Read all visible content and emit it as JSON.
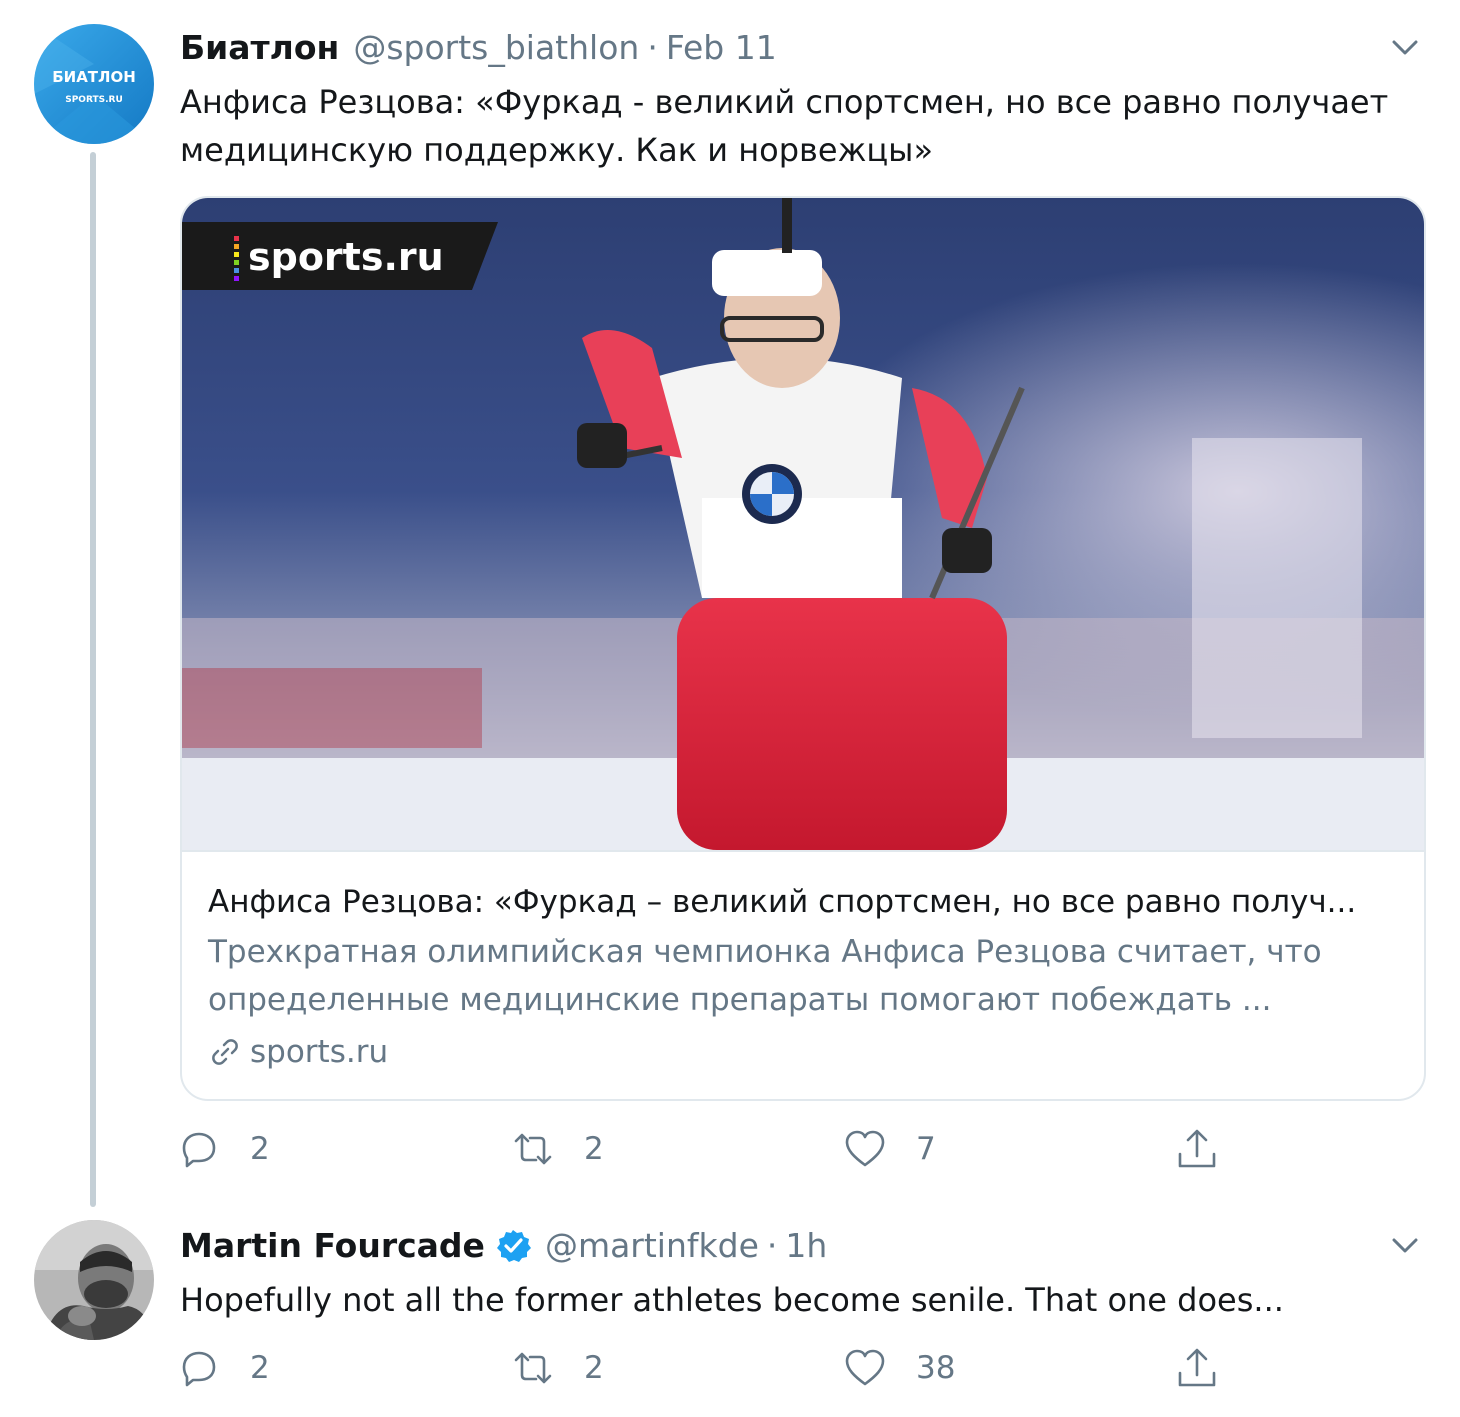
{
  "tweets": [
    {
      "author_name": "Биатлон",
      "handle": "@sports_biathlon",
      "separator": "·",
      "time": "Feb 11",
      "avatar_text_top": "БИАТЛОН",
      "avatar_text_bottom": "SPORTS.RU",
      "text": "Анфиса Резцова: «Фуркад - великий спортсмен, но все равно получает медицинскую поддержку. Как и норвежцы»",
      "card": {
        "image_logo": "sports.ru",
        "headline": "Анфиса Резцова: «Фуркад – великий спортсмен, но все равно получ...",
        "description": "Трехкратная олимпийская чемпионка Анфиса Резцова считает, что определенные медицинские препараты помогают побеждать ...",
        "domain": "sports.ru"
      },
      "replies": "2",
      "retweets": "2",
      "likes": "7"
    },
    {
      "author_name": "Martin Fourcade",
      "verified": true,
      "handle": "@martinfkde",
      "separator": "·",
      "time": "1h",
      "text": "Hopefully not all the former athletes become senile. That one does...",
      "replies": "2",
      "retweets": "2",
      "likes": "38"
    }
  ],
  "icons": {
    "more": "chevron-down-icon",
    "reply": "reply-icon",
    "retweet": "retweet-icon",
    "like": "heart-icon",
    "share": "share-icon",
    "link": "link-icon",
    "verified": "verified-badge-icon"
  },
  "colors": {
    "text": "#14171a",
    "secondary": "#657786",
    "border": "#e1e8ed",
    "verified": "#1da1f2",
    "avatar_blue": "#1a8fd6"
  }
}
